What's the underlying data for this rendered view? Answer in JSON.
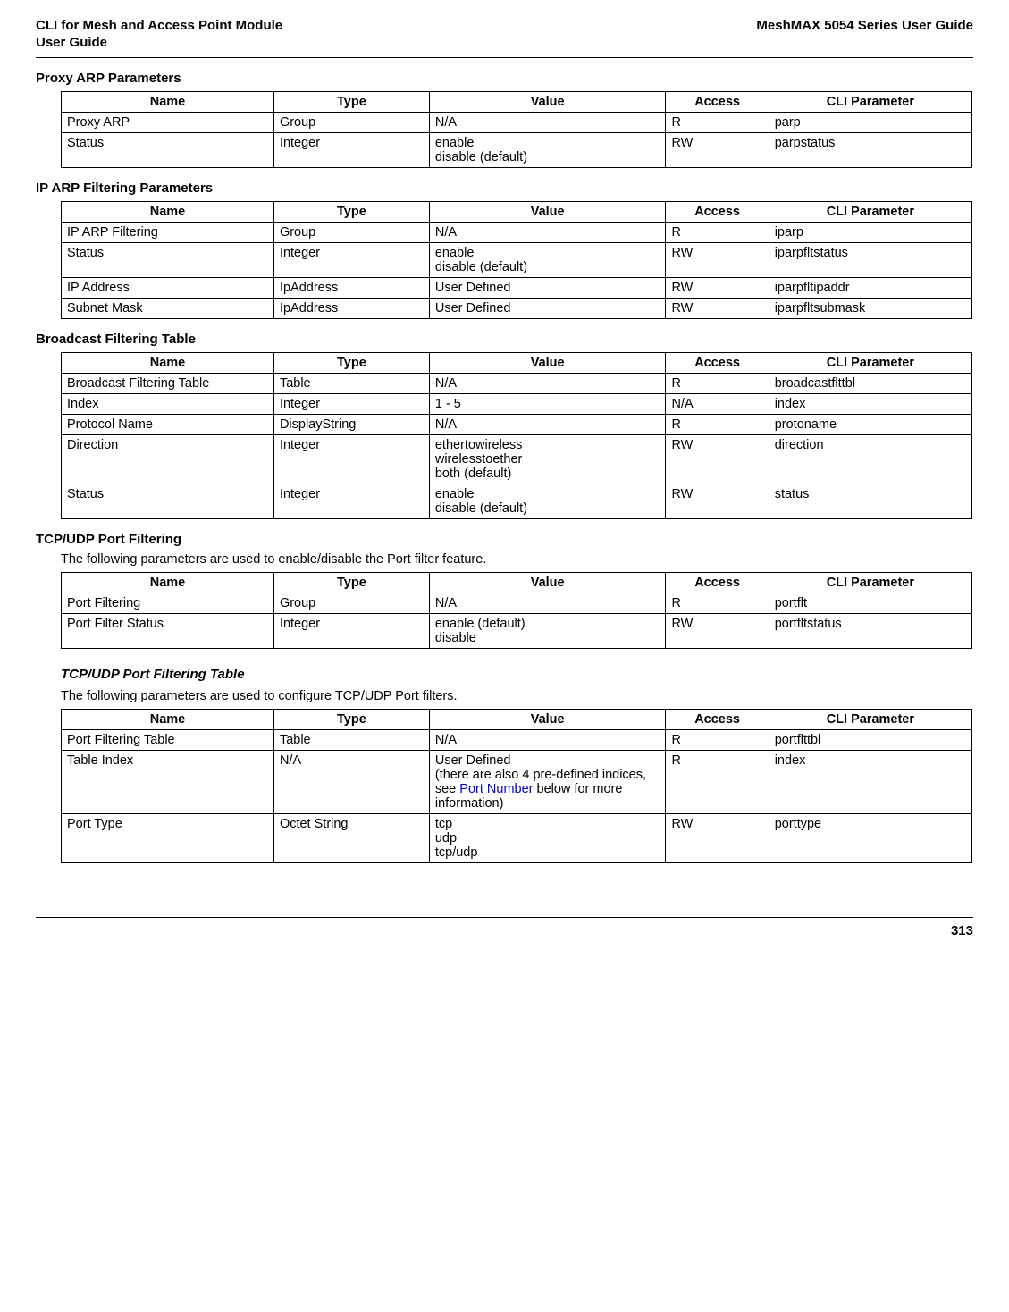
{
  "header": {
    "left_line1": "CLI for Mesh and Access Point Module",
    "left_line2": " User Guide",
    "right": "MeshMAX 5054 Series User Guide"
  },
  "columns": {
    "name": "Name",
    "type": "Type",
    "value": "Value",
    "access": "Access",
    "cli": "CLI Parameter"
  },
  "sections": {
    "proxy_arp": {
      "heading": "Proxy ARP Parameters",
      "rows": [
        {
          "name": "Proxy ARP",
          "type": "Group",
          "value": "N/A",
          "access": "R",
          "cli": "parp"
        },
        {
          "name": "Status",
          "type": "Integer",
          "value": "enable\ndisable (default)",
          "access": "RW",
          "cli": "parpstatus"
        }
      ]
    },
    "ip_arp_filtering": {
      "heading": "IP ARP Filtering Parameters",
      "rows": [
        {
          "name": "IP ARP Filtering",
          "type": "Group",
          "value": "N/A",
          "access": "R",
          "cli": "iparp"
        },
        {
          "name": "Status",
          "type": "Integer",
          "value": "enable\ndisable (default)",
          "access": "RW",
          "cli": "iparpfltstatus"
        },
        {
          "name": "IP Address",
          "type": "IpAddress",
          "value": "User Defined",
          "access": "RW",
          "cli": "iparpfltipaddr"
        },
        {
          "name": "Subnet Mask",
          "type": "IpAddress",
          "value": "User Defined",
          "access": "RW",
          "cli": "iparpfltsubmask"
        }
      ]
    },
    "broadcast_filtering": {
      "heading": "Broadcast Filtering Table",
      "rows": [
        {
          "name": "Broadcast Filtering Table",
          "type": "Table",
          "value": "N/A",
          "access": "R",
          "cli": "broadcastflttbl"
        },
        {
          "name": "Index",
          "type": "Integer",
          "value": "1 - 5",
          "access": "N/A",
          "cli": "index"
        },
        {
          "name": "Protocol Name",
          "type": "DisplayString",
          "value": "N/A",
          "access": "R",
          "cli": "protoname"
        },
        {
          "name": "Direction",
          "type": "Integer",
          "value": "ethertowireless\nwirelesstoether\nboth (default)",
          "access": "RW",
          "cli": "direction"
        },
        {
          "name": "Status",
          "type": "Integer",
          "value": "enable\ndisable (default)",
          "access": "RW",
          "cli": "status"
        }
      ]
    },
    "tcpudp_port_filtering": {
      "heading": "TCP/UDP Port Filtering",
      "intro": "The following parameters are used to enable/disable the Port filter feature.",
      "rows": [
        {
          "name": "Port Filtering",
          "type": "Group",
          "value": "N/A",
          "access": "R",
          "cli": "portflt"
        },
        {
          "name": "Port Filter Status",
          "type": "Integer",
          "value": "enable (default)\ndisable",
          "access": "RW",
          "cli": "portfltstatus"
        }
      ]
    },
    "tcpudp_port_filtering_table": {
      "heading": "TCP/UDP Port Filtering Table",
      "intro": "The following parameters are used to configure TCP/UDP Port filters.",
      "rows": [
        {
          "name": "Port Filtering Table",
          "type": "Table",
          "value": "N/A",
          "access": "R",
          "cli": "portflttbl"
        },
        {
          "name": "Table Index",
          "type": "N/A",
          "value_pre": "User Defined\n(there are also 4 pre-defined indices, see ",
          "value_link": "Port Number",
          "value_post": " below for more information)",
          "access": "R",
          "cli": "index"
        },
        {
          "name": "Port Type",
          "type": "Octet String",
          "value": "tcp\nudp\ntcp/udp",
          "access": "RW",
          "cli": "porttype"
        }
      ]
    }
  },
  "footer": {
    "page_number": "313"
  }
}
